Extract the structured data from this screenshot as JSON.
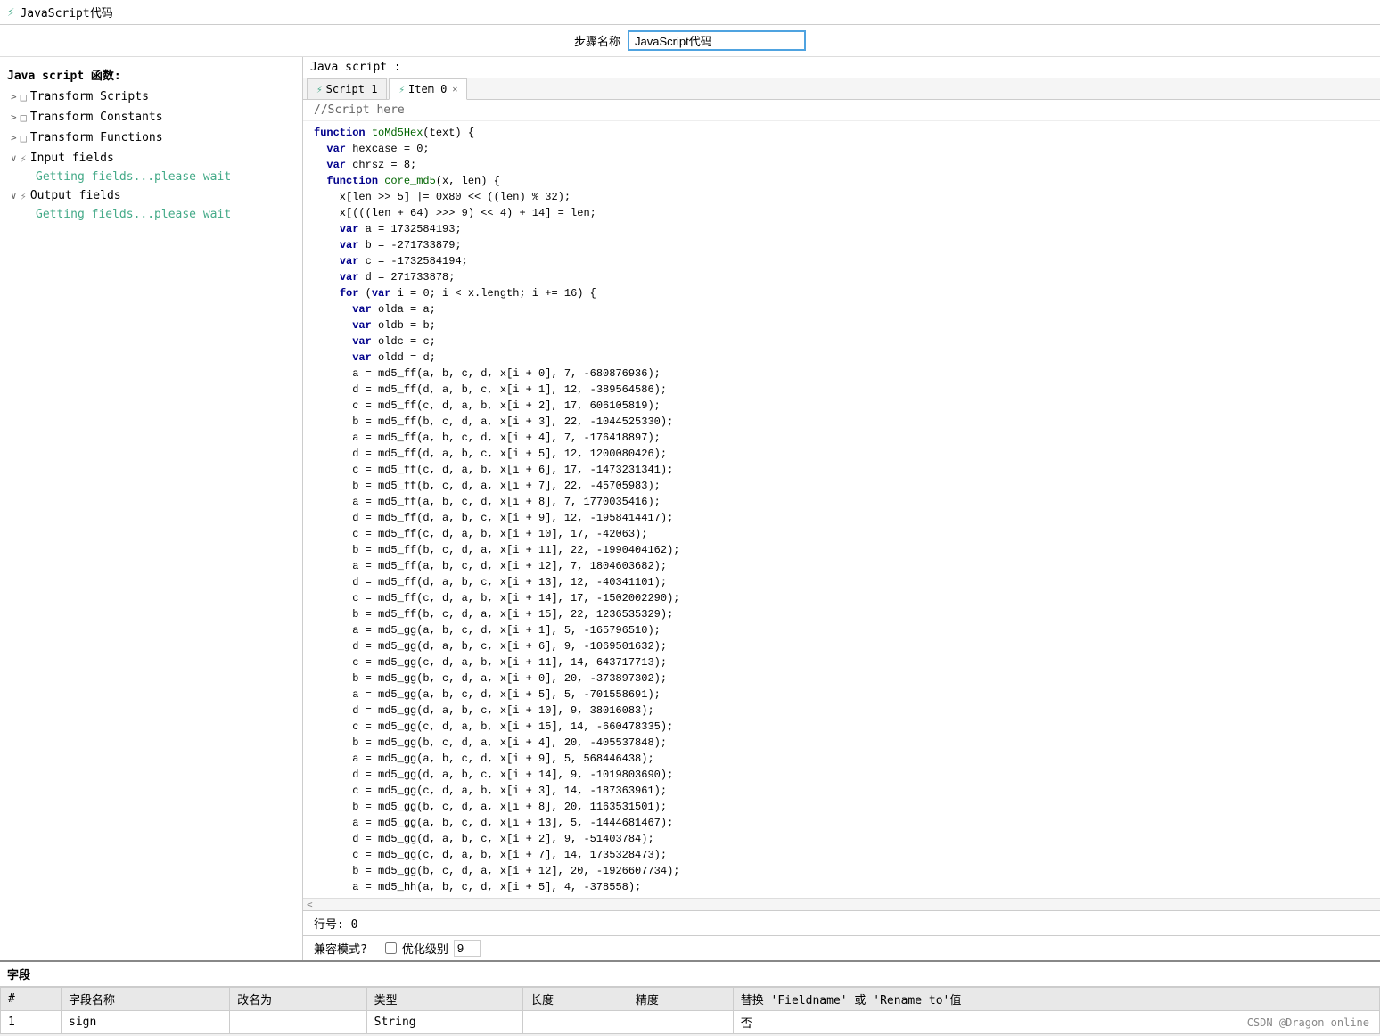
{
  "titleBar": {
    "icon": "⚡",
    "title": "JavaScript代码"
  },
  "stepName": {
    "label": "步骤名称",
    "value": "JavaScript代码"
  },
  "leftPanel": {
    "jsLabel": "Java script 函数:",
    "treeItems": [
      {
        "id": "transform-scripts",
        "arrow": ">",
        "icon": "□",
        "label": "Transform Scripts"
      },
      {
        "id": "transform-constants",
        "arrow": ">",
        "icon": "□",
        "label": "Transform Constants"
      },
      {
        "id": "transform-functions",
        "arrow": ">",
        "icon": "□",
        "label": "Transform Functions"
      },
      {
        "id": "input-fields",
        "arrow": "∨",
        "icon": "⚡",
        "label": "Input fields"
      }
    ],
    "gettingFields1": "Getting fields...please wait",
    "outputFieldsLabel": "Output fields",
    "outputArrow": "∨",
    "outputIcon": "⚡",
    "gettingFields2": "Getting fields...please wait"
  },
  "rightPanel": {
    "jsLabel": "Java script :",
    "tabs": [
      {
        "id": "script1",
        "icon": "⚡",
        "label": "Script 1",
        "active": false,
        "closable": false
      },
      {
        "id": "item0",
        "icon": "⚡",
        "label": "Item 0",
        "active": true,
        "closable": true
      }
    ],
    "comment": "//Script here",
    "code": [
      {
        "type": "kw-fn",
        "text": "function toMd5Hex(text) {"
      },
      {
        "type": "indent1-kw",
        "text": "  var hexcase = 0;"
      },
      {
        "type": "indent1-kw",
        "text": "  var chrsz = 8;"
      },
      {
        "type": "blank",
        "text": ""
      },
      {
        "type": "indent1-kw",
        "text": "  function core_md5(x, len) {"
      },
      {
        "type": "indent2",
        "text": "    x[len >> 5] |= 0x80 << ((len) % 32);"
      },
      {
        "type": "indent2",
        "text": "    x[(((len + 64) >>> 9) << 4) + 14] = len;"
      },
      {
        "type": "indent2-kw",
        "text": "    var a = 1732584193;"
      },
      {
        "type": "indent2-kw",
        "text": "    var b = -271733879;"
      },
      {
        "type": "indent2-kw",
        "text": "    var c = -1732584194;"
      },
      {
        "type": "indent2-kw",
        "text": "    var d = 271733878;"
      },
      {
        "type": "indent2-kw",
        "text": "    for (var i = 0; i < x.length; i += 16) {"
      },
      {
        "type": "indent3-kw",
        "text": "      var olda = a;"
      },
      {
        "type": "indent3-kw",
        "text": "      var oldb = b;"
      },
      {
        "type": "indent3-kw",
        "text": "      var oldc = c;"
      },
      {
        "type": "indent3-kw",
        "text": "      var oldd = d;"
      },
      {
        "type": "indent3",
        "text": "      a = md5_ff(a, b, c, d, x[i + 0], 7, -680876936);"
      },
      {
        "type": "indent3",
        "text": "      d = md5_ff(d, a, b, c, x[i + 1], 12, -389564586);"
      },
      {
        "type": "indent3",
        "text": "      c = md5_ff(c, d, a, b, x[i + 2], 17, 606105819);"
      },
      {
        "type": "indent3",
        "text": "      b = md5_ff(b, c, d, a, x[i + 3], 22, -1044525330);"
      },
      {
        "type": "indent3",
        "text": "      a = md5_ff(a, b, c, d, x[i + 4], 7, -176418897);"
      },
      {
        "type": "indent3",
        "text": "      d = md5_ff(d, a, b, c, x[i + 5], 12, 1200080426);"
      },
      {
        "type": "indent3",
        "text": "      c = md5_ff(c, d, a, b, x[i + 6], 17, -1473231341);"
      },
      {
        "type": "indent3",
        "text": "      b = md5_ff(b, c, d, a, x[i + 7], 22, -45705983);"
      },
      {
        "type": "indent3",
        "text": "      a = md5_ff(a, b, c, d, x[i + 8], 7, 1770035416);"
      },
      {
        "type": "indent3",
        "text": "      d = md5_ff(d, a, b, c, x[i + 9], 12, -1958414417);"
      },
      {
        "type": "indent3",
        "text": "      c = md5_ff(c, d, a, b, x[i + 10], 17, -42063);"
      },
      {
        "type": "indent3",
        "text": "      b = md5_ff(b, c, d, a, x[i + 11], 22, -1990404162);"
      },
      {
        "type": "indent3",
        "text": "      a = md5_ff(a, b, c, d, x[i + 12], 7, 1804603682);"
      },
      {
        "type": "indent3",
        "text": "      d = md5_ff(d, a, b, c, x[i + 13], 12, -40341101);"
      },
      {
        "type": "indent3",
        "text": "      c = md5_ff(c, d, a, b, x[i + 14], 17, -1502002290);"
      },
      {
        "type": "indent3",
        "text": "      b = md5_ff(b, c, d, a, x[i + 15], 22, 1236535329);"
      },
      {
        "type": "indent3",
        "text": "      a = md5_gg(a, b, c, d, x[i + 1], 5, -165796510);"
      },
      {
        "type": "indent3",
        "text": "      d = md5_gg(d, a, b, c, x[i + 6], 9, -1069501632);"
      },
      {
        "type": "indent3",
        "text": "      c = md5_gg(c, d, a, b, x[i + 11], 14, 643717713);"
      },
      {
        "type": "indent3",
        "text": "      b = md5_gg(b, c, d, a, x[i + 0], 20, -373897302);"
      },
      {
        "type": "indent3",
        "text": "      a = md5_gg(a, b, c, d, x[i + 5], 5, -701558691);"
      },
      {
        "type": "indent3",
        "text": "      d = md5_gg(d, a, b, c, x[i + 10], 9, 38016083);"
      },
      {
        "type": "indent3",
        "text": "      c = md5_gg(c, d, a, b, x[i + 15], 14, -660478335);"
      },
      {
        "type": "indent3",
        "text": "      b = md5_gg(b, c, d, a, x[i + 4], 20, -405537848);"
      },
      {
        "type": "indent3",
        "text": "      a = md5_gg(a, b, c, d, x[i + 9], 5, 568446438);"
      },
      {
        "type": "indent3",
        "text": "      d = md5_gg(d, a, b, c, x[i + 14], 9, -1019803690);"
      },
      {
        "type": "indent3",
        "text": "      c = md5_gg(c, d, a, b, x[i + 3], 14, -187363961);"
      },
      {
        "type": "indent3",
        "text": "      b = md5_gg(b, c, d, a, x[i + 8], 20, 1163531501);"
      },
      {
        "type": "indent3",
        "text": "      a = md5_gg(a, b, c, d, x[i + 13], 5, -1444681467);"
      },
      {
        "type": "indent3",
        "text": "      d = md5_gg(d, a, b, c, x[i + 2], 9, -51403784);"
      },
      {
        "type": "indent3",
        "text": "      c = md5_gg(c, d, a, b, x[i + 7], 14, 1735328473);"
      },
      {
        "type": "indent3",
        "text": "      b = md5_gg(b, c, d, a, x[i + 12], 20, -1926607734);"
      },
      {
        "type": "indent3",
        "text": "      a = md5_hh(a, b, c, d, x[i + 5], 4, -378558);"
      }
    ],
    "lineNumber": "行号: 0",
    "compatMode": "兼容模式?",
    "optimizeLabel": "优化级别",
    "optimizeValue": "9"
  },
  "fieldsSection": {
    "title": "字段",
    "columns": [
      "#",
      "字段名称",
      "改名为",
      "类型",
      "长度",
      "精度",
      "替换 'Fieldname' 或 'Rename to'值"
    ],
    "rows": [
      {
        "num": "1",
        "name": "sign",
        "renameTo": "",
        "type": "String",
        "length": "",
        "precision": "",
        "replace": "否"
      }
    ]
  },
  "watermark": "CSDN @Dragon online"
}
